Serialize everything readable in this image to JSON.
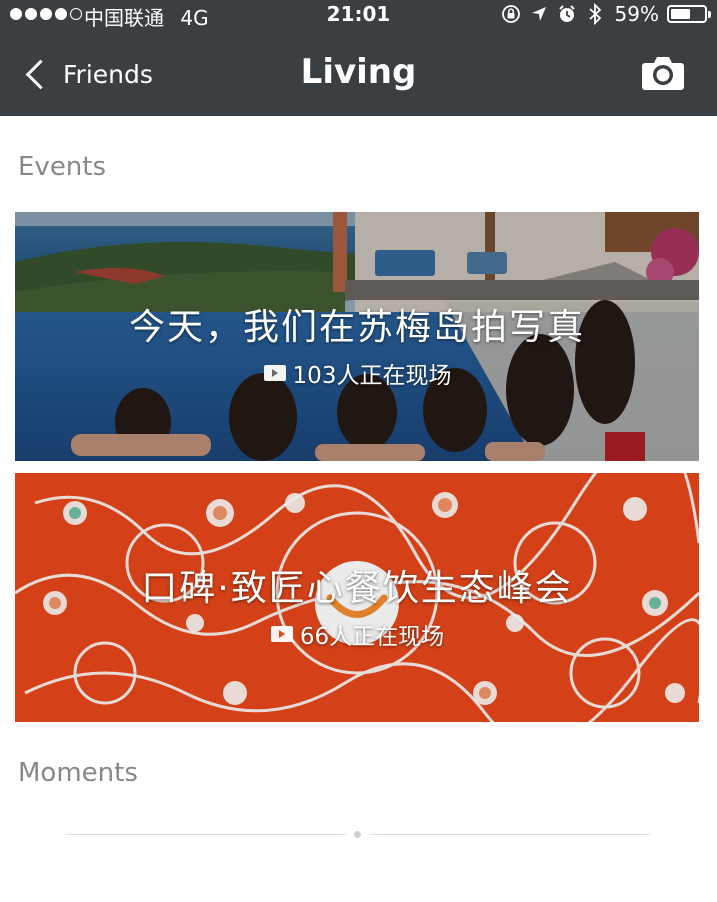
{
  "status_bar": {
    "carrier": "中国联通",
    "network": "4G",
    "time": "21:01",
    "battery_percent": "59%",
    "battery_level": 0.59,
    "signal_bars_filled": 4,
    "signal_bars_total": 5
  },
  "nav": {
    "back_label": "Friends",
    "title": "Living"
  },
  "sections": {
    "events_title": "Events",
    "moments_title": "Moments"
  },
  "events": [
    {
      "title": "今天，我们在苏梅岛拍写真",
      "viewers": "103人正在现场"
    },
    {
      "title": "口碑·致匠心餐饮生态峰会",
      "viewers": "66人正在现场"
    }
  ],
  "colors": {
    "header_bg": "#3a3f44",
    "event2_bg": "#e6471b",
    "section_text": "#888888"
  },
  "icons": [
    "lock-rotation-icon",
    "location-icon",
    "alarm-icon",
    "bluetooth-icon",
    "battery-icon",
    "back-chevron-icon",
    "camera-icon",
    "live-video-icon"
  ]
}
